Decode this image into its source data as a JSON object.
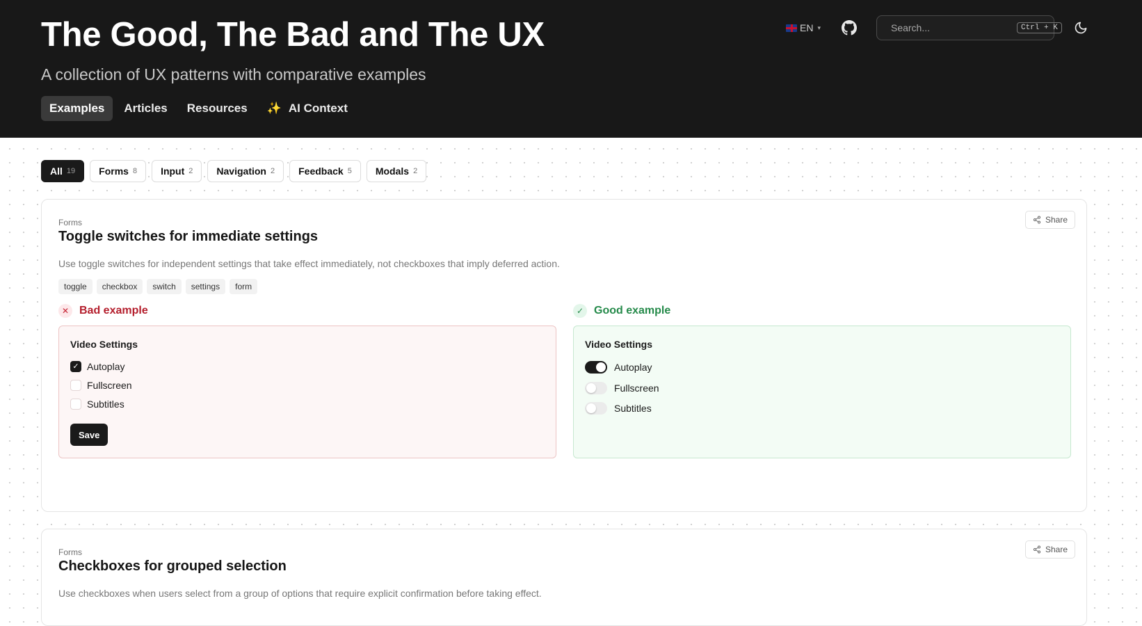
{
  "header": {
    "title": "The Good, The Bad and The UX",
    "subtitle": "A collection of UX patterns with comparative examples",
    "nav": [
      {
        "label": "Examples",
        "active": true
      },
      {
        "label": "Articles",
        "active": false
      },
      {
        "label": "Resources",
        "active": false
      },
      {
        "label": "AI Context",
        "active": false,
        "icon": "sparkle-icon"
      }
    ],
    "language": "EN",
    "search": {
      "placeholder": "Search...",
      "shortcut": "Ctrl + K"
    }
  },
  "filters": [
    {
      "label": "All",
      "count": "19",
      "active": true
    },
    {
      "label": "Forms",
      "count": "8"
    },
    {
      "label": "Input",
      "count": "2"
    },
    {
      "label": "Navigation",
      "count": "2"
    },
    {
      "label": "Feedback",
      "count": "5"
    },
    {
      "label": "Modals",
      "count": "2"
    }
  ],
  "cards": [
    {
      "category": "Forms",
      "title": "Toggle switches for immediate settings",
      "description": "Use toggle switches for independent settings that take effect immediately, not checkboxes that imply deferred action.",
      "share_label": "Share",
      "tags": [
        "toggle",
        "checkbox",
        "switch",
        "settings",
        "form"
      ],
      "bad": {
        "label": "Bad example",
        "panel_title": "Video Settings",
        "options": [
          {
            "label": "Autoplay",
            "checked": true
          },
          {
            "label": "Fullscreen",
            "checked": false
          },
          {
            "label": "Subtitles",
            "checked": false
          }
        ],
        "save_label": "Save"
      },
      "good": {
        "label": "Good example",
        "panel_title": "Video Settings",
        "options": [
          {
            "label": "Autoplay",
            "on": true
          },
          {
            "label": "Fullscreen",
            "on": false
          },
          {
            "label": "Subtitles",
            "on": false
          }
        ]
      }
    },
    {
      "category": "Forms",
      "title": "Checkboxes for grouped selection",
      "description": "Use checkboxes when users select from a group of options that require explicit confirmation before taking effect.",
      "share_label": "Share"
    }
  ],
  "colors": {
    "header_bg": "#181818",
    "bad": "#b41e2c",
    "good": "#258a4a",
    "accent_dark": "#1a1a1a"
  }
}
